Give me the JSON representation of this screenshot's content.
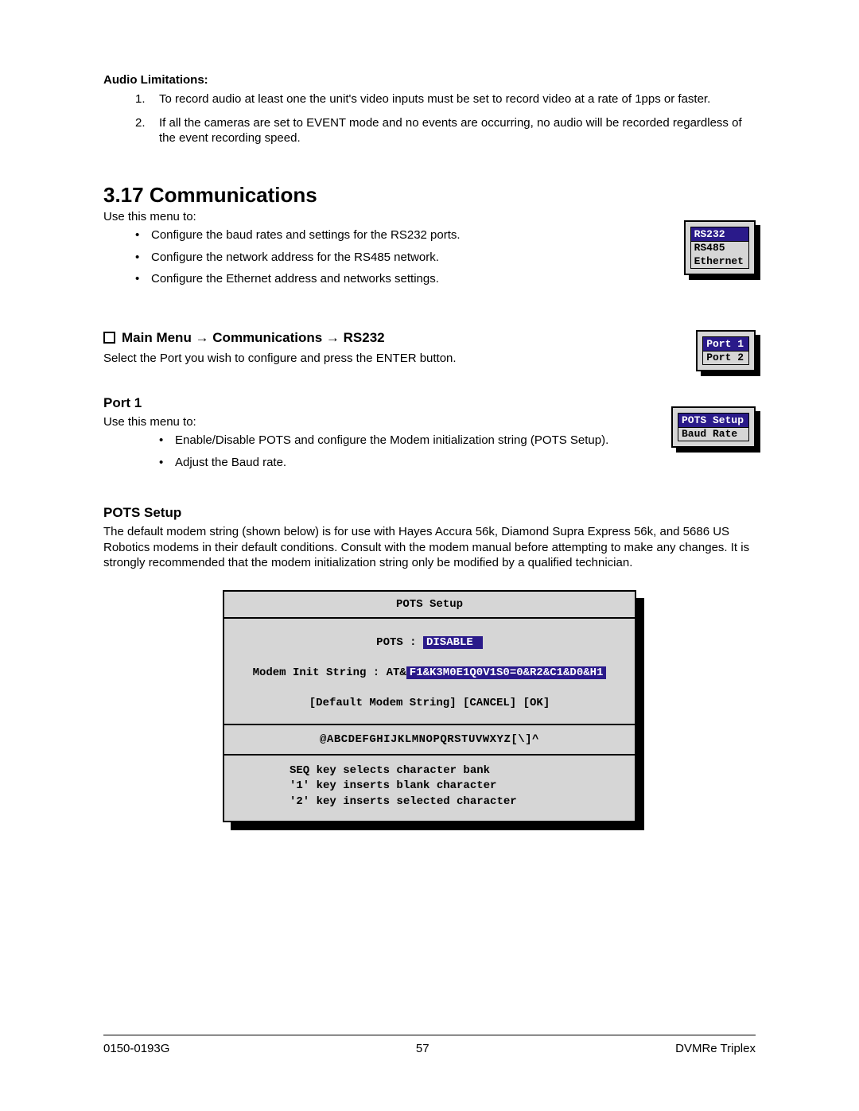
{
  "audio": {
    "heading": "Audio Limitations:",
    "items": [
      {
        "num": "1.",
        "text": "To record audio at least one the unit's video inputs must be set to record video at a rate of 1pps or faster."
      },
      {
        "num": "2.",
        "text": "If all the cameras are set to EVENT mode and no events are occurring, no audio will be recorded regardless of the event recording speed."
      }
    ]
  },
  "comm": {
    "heading": "3.17 Communications",
    "intro": "Use this menu to:",
    "bullets": [
      "Configure the baud rates and settings for the RS232 ports.",
      "Configure the network address for the RS485 network.",
      "Configure the Ethernet address and networks settings."
    ],
    "menu1": [
      "RS232",
      "RS485",
      "Ethernet"
    ]
  },
  "nav": {
    "heading": "Main Menu → Communications → RS232",
    "desc": "Select the Port you wish to configure and press the ENTER button.",
    "menu2": [
      "Port 1",
      "Port 2"
    ]
  },
  "port1": {
    "heading": "Port 1",
    "intro": "Use this menu to:",
    "bullets": [
      "Enable/Disable POTS and configure the Modem initialization string (POTS Setup).",
      "Adjust the Baud rate."
    ],
    "menu3": [
      "POTS Setup",
      "Baud Rate"
    ]
  },
  "pots": {
    "heading": "POTS Setup",
    "desc": "The default modem string (shown below) is for use with Hayes Accura 56k, Diamond Supra Express 56k, and 5686 US Robotics modems in their default conditions.  Consult with the modem manual before attempting to make any changes.  It is strongly recommended that the modem initialization string only be modified by a qualified technician.",
    "dialog": {
      "title": "POTS Setup",
      "pots_label": "POTS :",
      "pots_value": "DISABLE",
      "modem_label": "Modem Init String : AT&",
      "modem_value": "F1&K3M0E1Q0V1S0=0&R2&C1&D0&H1",
      "buttons": "[Default Modem String]   [CANCEL]   [OK]",
      "chars": "@ABCDEFGHIJKLMNOPQRSTUVWXYZ[\\]^",
      "help1": "SEQ key selects character bank",
      "help2": "'1' key inserts blank character",
      "help3": "'2' key inserts selected character"
    }
  },
  "footer": {
    "left": "0150-0193G",
    "center": "57",
    "right": "DVMRe Triplex"
  }
}
